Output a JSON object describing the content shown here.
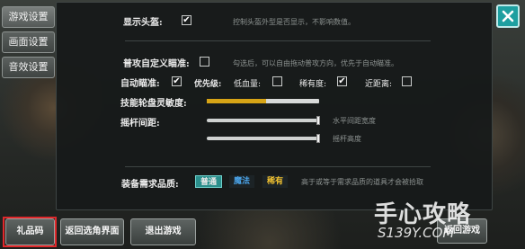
{
  "side_tabs": [
    {
      "label": "游戏设置"
    },
    {
      "label": "画面设置"
    },
    {
      "label": "音效设置"
    }
  ],
  "settings": {
    "show_head": {
      "label": "显示头盔:",
      "checked": true,
      "hint": "控制头盔外型是否显示，不影响数值。"
    },
    "custom_aim": {
      "label": "普攻自定义瞄准:",
      "checked": false,
      "hint": "勾选后，可以自由拖动普攻方向，优先于自动瞄准。"
    },
    "auto_aim": {
      "label": "自动瞄准:",
      "checked": true,
      "priority_label": "优先级:",
      "options": [
        {
          "label": "低血量:",
          "checked": false
        },
        {
          "label": "稀有度:",
          "checked": true
        },
        {
          "label": "近距离:",
          "checked": false
        }
      ]
    },
    "skill_sensitivity": {
      "label": "技能轮盘灵敏度:",
      "level": 0.53
    },
    "joystick_spacing": {
      "label": "摇杆间距:",
      "sliders": [
        {
          "hint": "水平间距宽度",
          "level": 1.0
        },
        {
          "hint": "摇杆高度",
          "level": 1.0
        }
      ]
    },
    "equip_quality": {
      "label": "装备需求品质:",
      "options": [
        {
          "label": "普通",
          "color": "#e8e8e8",
          "bg": "#2b8f8c",
          "selected": true
        },
        {
          "label": "魔法",
          "color": "#4aa3e8",
          "bg": "#1c2326",
          "selected": false
        },
        {
          "label": "稀有",
          "color": "#f2c230",
          "bg": "#1c2326",
          "selected": false
        }
      ],
      "hint": "高于或等于需求品质的道具才会被拾取"
    }
  },
  "icons": {
    "close": "close-icon",
    "check": "check-icon"
  },
  "bottom_buttons": [
    {
      "label": "礼品码"
    },
    {
      "label": "返回选角界面"
    },
    {
      "label": "退出游戏"
    }
  ],
  "hidden_button": {
    "label": "返回游戏"
  },
  "watermark": {
    "cn": "手心攻略",
    "url": "S139Y.COM"
  }
}
